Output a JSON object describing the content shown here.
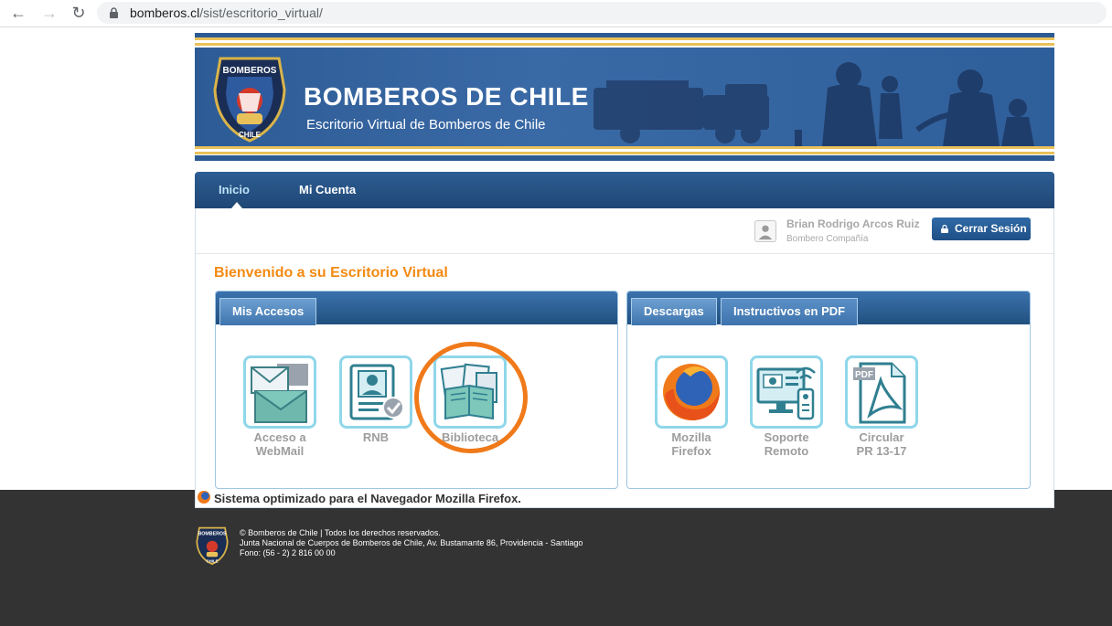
{
  "browser": {
    "url_host": "bomberos.cl",
    "url_path": "/sist/escritorio_virtual/"
  },
  "banner": {
    "title": "BOMBEROS DE CHILE",
    "subtitle": "Escritorio Virtual de Bomberos de Chile",
    "logo_text": "BOMBEROS",
    "logo_country": "CHILE"
  },
  "nav": {
    "items": [
      {
        "label": "Inicio",
        "active": true
      },
      {
        "label": "Mi Cuenta",
        "active": false
      }
    ]
  },
  "user": {
    "name": "Brian Rodrigo Arcos Ruiz",
    "role": "Bombero Compañía",
    "logout_label": "Cerrar Sesión"
  },
  "welcome": "Bienvenido a su Escritorio Virtual",
  "panels": {
    "left": {
      "tabs": [
        "Mis Accesos"
      ],
      "tiles": [
        {
          "label_1": "Acceso a",
          "label_2": "WebMail",
          "icon": "mail-icon"
        },
        {
          "label_1": "RNB",
          "label_2": "",
          "icon": "id-card-icon"
        },
        {
          "label_1": "Biblioteca",
          "label_2": "",
          "icon": "books-icon"
        }
      ]
    },
    "right": {
      "tabs": [
        "Descargas",
        "Instructivos en PDF"
      ],
      "tiles": [
        {
          "label_1": "Mozilla",
          "label_2": "Firefox",
          "icon": "firefox-icon"
        },
        {
          "label_1": "Soporte",
          "label_2": "Remoto",
          "icon": "remote-support-icon"
        },
        {
          "label_1": "Circular",
          "label_2": "PR 13-17",
          "icon": "pdf-icon"
        }
      ]
    }
  },
  "optimized_note": "Sistema optimizado para el Navegador Mozilla Firefox.",
  "footer": {
    "line1": "© Bomberos de Chile | Todos los derechos reservados.",
    "line2": "Junta Nacional de Cuerpos de Bomberos de Chile, Av. Bustamante 86, Providencia - Santiago",
    "line3": "Fono: (56 - 2) 2 816 00 00"
  },
  "colors": {
    "brand_blue": "#2d5b95",
    "accent_orange": "#f38a12",
    "tile_border": "#8fd7ea",
    "highlight": "#f07a1a"
  }
}
